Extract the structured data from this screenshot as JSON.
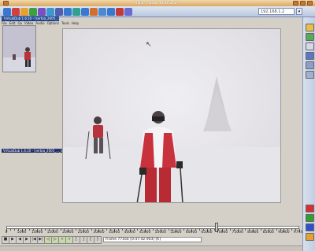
{
  "vnc": {
    "title": "xp1 ( 192.168.1.2 )",
    "address": "192.168.1.2",
    "toolbar_icons": [
      "connect-icon",
      "disconnect-icon",
      "options-icon",
      "refresh-icon",
      "ctrl-alt-del-icon",
      "start-icon",
      "fullscreen-icon",
      "scale-icon",
      "zoom-in-icon",
      "zoom-out-icon",
      "chat-icon",
      "transfer-icon",
      "info-icon",
      "close-session-icon",
      "about-icon"
    ]
  },
  "virtualdub": {
    "window_title": "VirtualDub 1.6.10 - [serbia_2005_..._serbia_2005_1056.AVI]",
    "menu": [
      "File",
      "Edit",
      "Go",
      "Video",
      "Audio",
      "Options",
      "Tools",
      "Help"
    ],
    "frame_status": "Frame 77164 [0:47:42.903] [K]",
    "timeline_labels": [
      "0",
      "5000",
      "10000",
      "15000",
      "20000",
      "25000",
      "30000",
      "35000",
      "40000",
      "45000",
      "50000",
      "55000",
      "60000",
      "65000",
      "70000",
      "75000",
      "80000",
      "85000",
      "90000",
      "97943"
    ],
    "timeline_position_fraction": 0.717,
    "control_buttons": [
      "stop",
      "play",
      "prev",
      "next",
      "start",
      "end",
      "key-prev",
      "key-next",
      "scene-prev",
      "scene-next",
      "mark-in",
      "mark-out",
      "mark-in2",
      "mark-out2"
    ]
  },
  "colors": {
    "vnc_titlebar": "#e6b980",
    "vd_titlebar": "#2a4f98",
    "desktop": "#d4d0c8"
  }
}
